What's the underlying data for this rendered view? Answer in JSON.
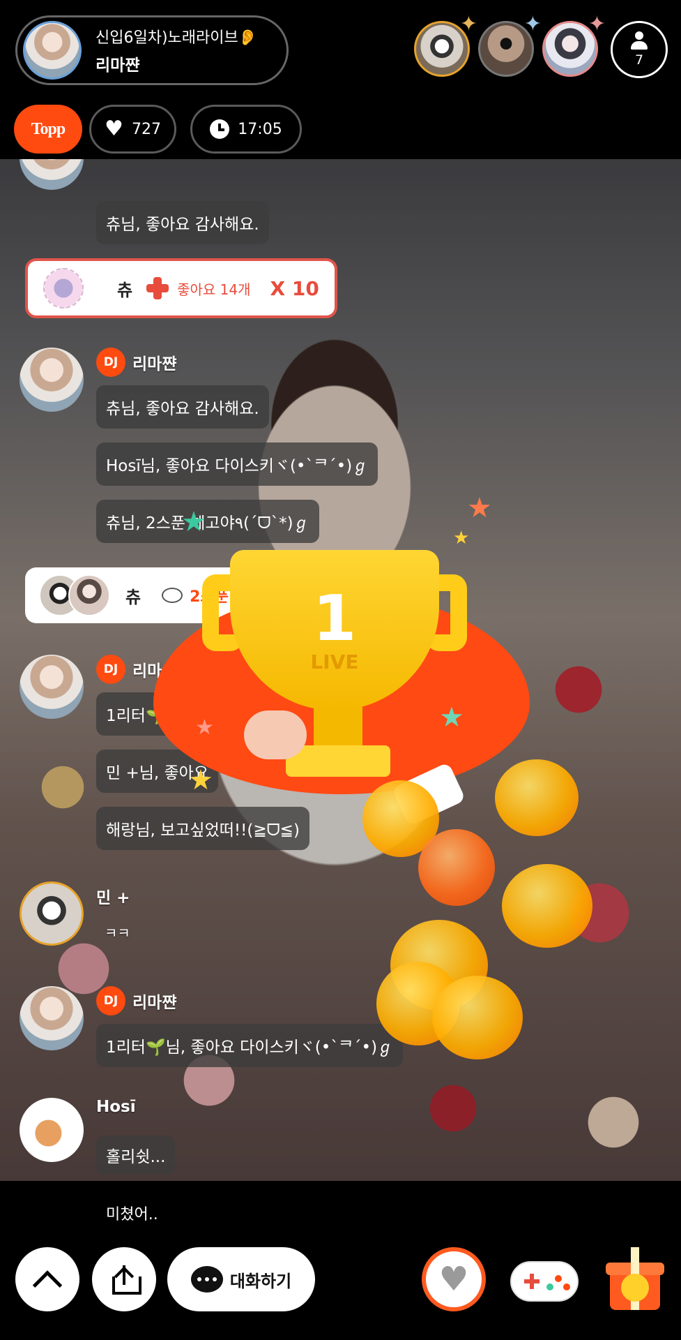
{
  "header": {
    "title": "신입6일차)노래라이브👂",
    "host_name": "리마쨘",
    "viewer_count": "7",
    "badge": "Topp",
    "likes": "727",
    "elapsed": "17:05"
  },
  "chat": [
    {
      "nick": "",
      "messages": [
        "츄님, 좋아요 감사해요."
      ]
    },
    {
      "dj": "DJ",
      "nick": "리마쨘",
      "messages": [
        "츄님, 좋아요 감사해요.",
        "Hosī님, 좋아요 다이스키ヾ(•`ᄏ´•)ℊ",
        "츄님, 2스푼 체고야٩(´ᗜ`*)ℊ"
      ]
    },
    {
      "dj": "DJ",
      "nick": "리마",
      "messages": [
        "1리터🌱",
        "민 +님, 좋아요",
        "해랑님, 보고싶었떠!!(≧ᗜ≦)"
      ]
    },
    {
      "nick": "민 +",
      "messages": [
        "ㅋㅋ"
      ]
    },
    {
      "dj": "DJ",
      "nick": "리마쨘",
      "messages": [
        "1리터🌱님, 좋아요 다이스키ヾ(•`ᄏ´•)ℊ"
      ]
    },
    {
      "nick": "Hosī",
      "messages": [
        "홀리쉿..."
      ]
    }
  ],
  "gifts": [
    {
      "from": "츄",
      "item": "좋아요 14개",
      "multiplier": "X 10",
      "frame_label": "X10"
    },
    {
      "from": "츄",
      "item": "2스푼"
    }
  ],
  "trophy": {
    "rank": "1",
    "label": "LIVE"
  },
  "last_message": "미쳤어..",
  "bottom": {
    "chat_button_label": "대화하기"
  },
  "colors": {
    "accent": "#ff4a10",
    "bubble": "#3c3c3c",
    "gift_red": "#e74c3c"
  }
}
